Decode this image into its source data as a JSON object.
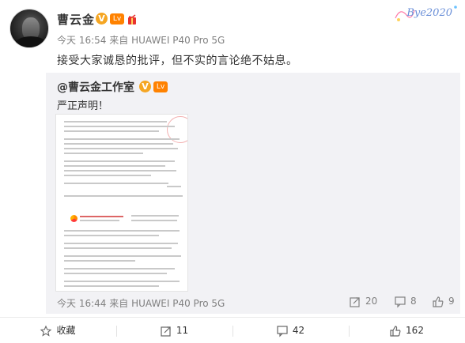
{
  "post": {
    "username": "曹云金",
    "verified_badge": "V",
    "level_badge": "Lv",
    "time": "今天 16:54",
    "source_prefix": "来自",
    "source": "HUAWEI P40 Pro 5G",
    "text": "接受大家诚恳的批评，但不实的言论绝不姑息。",
    "card_decoration": "Bye2020"
  },
  "repost": {
    "username": "@曹云金工作室",
    "verified_badge": "V",
    "level_badge": "Lv",
    "text": "严正声明！",
    "time": "今天 16:44",
    "source_prefix": "来自",
    "source": "HUAWEI P40 Pro 5G",
    "reposts": "20",
    "comments": "8",
    "likes": "9"
  },
  "actions": {
    "favorite_label": "收藏",
    "repost_count": "11",
    "comment_count": "42",
    "like_count": "162"
  },
  "colors": {
    "accent_orange": "#ff8200",
    "verified_gold": "#f5a623",
    "meta_gray": "#808080"
  }
}
